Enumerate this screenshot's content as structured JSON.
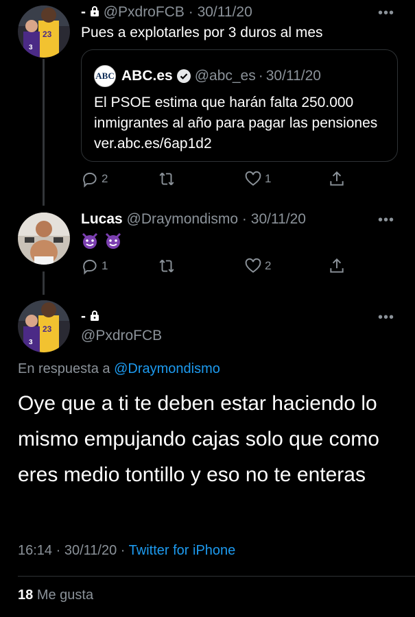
{
  "tweet1": {
    "name": "-",
    "handle": "@PxdroFCB",
    "date": "30/11/20",
    "text": "Pues a explotarles por 3 duros al mes",
    "quote": {
      "logo_text": "ABC",
      "name": "ABC.es",
      "handle": "@abc_es",
      "date": "30/11/20",
      "text": "El PSOE estima que harán falta 250.000 inmigrantes al año para pagar las pensiones ver.abc.es/6ap1d2"
    },
    "actions": {
      "replies": "2",
      "retweets": "",
      "likes": "1"
    }
  },
  "tweet2": {
    "name": "Lucas",
    "handle": "@Draymondismo",
    "date": "30/11/20",
    "actions": {
      "replies": "1",
      "retweets": "",
      "likes": "2"
    }
  },
  "main_tweet": {
    "name": "-",
    "handle": "@PxdroFCB",
    "reply_prefix": "En respuesta a",
    "reply_to": "@Draymondismo",
    "text": "Oye que a ti te deben estar haciendo lo mismo empujando cajas solo que como eres medio tontillo y eso no te enteras",
    "time": "16:14",
    "date": "30/11/20",
    "source": "Twitter for iPhone",
    "likes_count": "18",
    "likes_label": "Me gusta"
  },
  "separator": "·",
  "more_label": "•••",
  "colors": {
    "accent": "#1d9bf0",
    "muted": "#8b9299",
    "background": "#000000",
    "border": "#2f3336"
  },
  "icons": [
    "lock-icon",
    "verified-icon",
    "reply-icon",
    "retweet-icon",
    "like-icon",
    "share-icon",
    "more-icon",
    "devil-emoji"
  ]
}
